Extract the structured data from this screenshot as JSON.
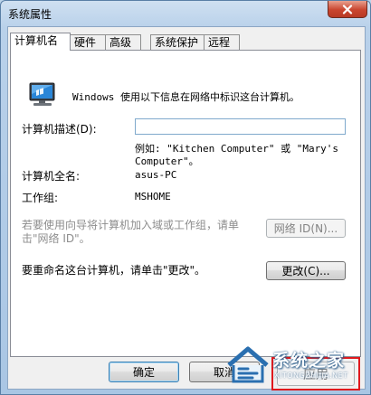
{
  "window": {
    "title": "系统属性"
  },
  "tabs": [
    {
      "label": "计算机名",
      "active": true
    },
    {
      "label": "硬件",
      "active": false
    },
    {
      "label": "高级",
      "active": false
    },
    {
      "label": "系统保护",
      "active": false
    },
    {
      "label": "远程",
      "active": false
    }
  ],
  "panel": {
    "intro": "Windows 使用以下信息在网络中标识这台计算机。",
    "description_label": "计算机描述(D):",
    "description_value": "",
    "example_line1": "例如: \"Kitchen Computer\" 或 \"Mary's",
    "example_line2": "Computer\"。",
    "fullname_label": "计算机全名:",
    "fullname_value": "asus-PC",
    "workgroup_label": "工作组:",
    "workgroup_value": "MSHOME",
    "join_text_line1": "若要使用向导将计算机加入域或工作组，请单",
    "join_text_line2": "击\"网络 ID\"。",
    "network_id_button": "网络 ID(N)...",
    "rename_text": "要重命名这台计算机，请单击\"更改\"。",
    "change_button": "更改(C)..."
  },
  "footer": {
    "ok_button": "确定",
    "cancel_button": "取消",
    "apply_button": "应用"
  },
  "watermark": {
    "title": "系统之家",
    "url": "XITONGZHIJIA.NET"
  },
  "colors": {
    "highlight": "#e0191d",
    "title_bar": "#b9d1ea",
    "close_button": "#c9452e"
  }
}
